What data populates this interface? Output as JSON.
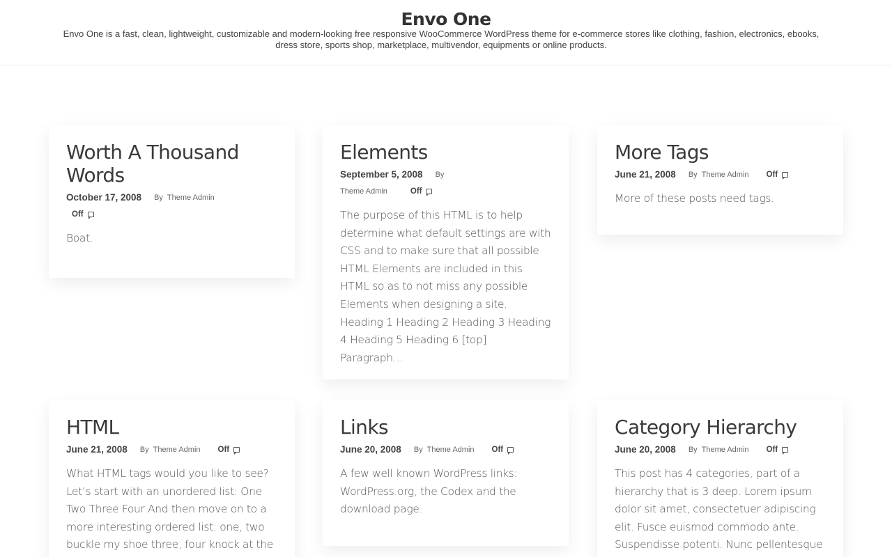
{
  "site": {
    "title": "Envo One",
    "description": "Envo One is a fast, clean, lightweight, customizable and modern-looking free responsive WooCommerce WordPress theme for e-commerce stores like clothing, fashion, electronics, ebooks, dress store, sports shop, marketplace, multivendor, equipments or online products."
  },
  "posts": [
    {
      "title": "Worth A Thousand Words",
      "date": "October 17, 2008",
      "by": "By",
      "author": "Theme Admin",
      "comments": "Off",
      "excerpt": "Boat."
    },
    {
      "title": "Elements",
      "date": "September 5, 2008",
      "by": "By",
      "author": "Theme Admin",
      "comments": "Off",
      "excerpt": "The purpose of this HTML is to help determine what default settings are with CSS and to make sure that all possible HTML Elements are included in this HTML so as to not miss any possible Elements when designing a site. Heading 1 Heading 2 Heading 3 Heading 4 Heading 5 Heading 6 [top] Paragraph…"
    },
    {
      "title": "More Tags",
      "date": "June 21, 2008",
      "by": "By",
      "author": "Theme Admin",
      "comments": "Off",
      "excerpt": "More of these posts need tags."
    },
    {
      "title": "HTML",
      "date": "June 21, 2008",
      "by": "By",
      "author": "Theme Admin",
      "comments": "Off",
      "excerpt": "What HTML tags would you like to see? Let’s start with an unordered list: One Two Three Four And then move on to a more interesting ordered list: one, two buckle my shoe three, four knock at the door Five, six pick up sticks"
    },
    {
      "title": "Links",
      "date": "June 20, 2008",
      "by": "By",
      "author": "Theme Admin",
      "comments": "Off",
      "excerpt": "A few well known WordPress links: WordPress.org, the Codex and the download page."
    },
    {
      "title": "Category Hierarchy",
      "date": "June 20, 2008",
      "by": "By",
      "author": "Theme Admin",
      "comments": "Off",
      "excerpt": "This post has 4 categories, part of a hierarchy that is 3 deep. Lorem ipsum dolor sit amet, consectetuer adipiscing elit. Fusce euismod commodo ante. Suspendisse potenti. Nunc pellentesque quam vel pede."
    }
  ]
}
